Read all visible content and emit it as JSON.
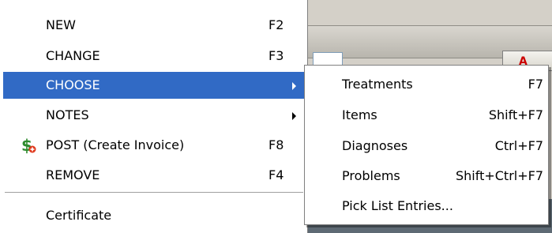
{
  "menu": {
    "items": [
      {
        "label": "NEW",
        "shortcut": "F2"
      },
      {
        "label": "CHANGE",
        "shortcut": "F3"
      },
      {
        "label": "CHOOSE",
        "shortcut": ""
      },
      {
        "label": "NOTES",
        "shortcut": ""
      },
      {
        "label": "POST (Create Invoice)",
        "shortcut": "F8",
        "icon": "dollar-icon"
      },
      {
        "label": "REMOVE",
        "shortcut": "F4"
      },
      {
        "label": "Certificate",
        "shortcut": ""
      }
    ]
  },
  "submenu": {
    "items": [
      {
        "label": "Treatments",
        "shortcut": "F7"
      },
      {
        "label": "Items",
        "shortcut": "Shift+F7"
      },
      {
        "label": "Diagnoses",
        "shortcut": "Ctrl+F7"
      },
      {
        "label": "Problems",
        "shortcut": "Shift+Ctrl+F7"
      },
      {
        "label": "Pick List Entries...",
        "shortcut": ""
      }
    ]
  },
  "background": {
    "tab_label": "A"
  },
  "colors": {
    "selection": "#316ac5",
    "menu_bg": "#ffffff",
    "window_bg": "#d4d0c8",
    "dollar_icon": "#2e8b2e"
  }
}
